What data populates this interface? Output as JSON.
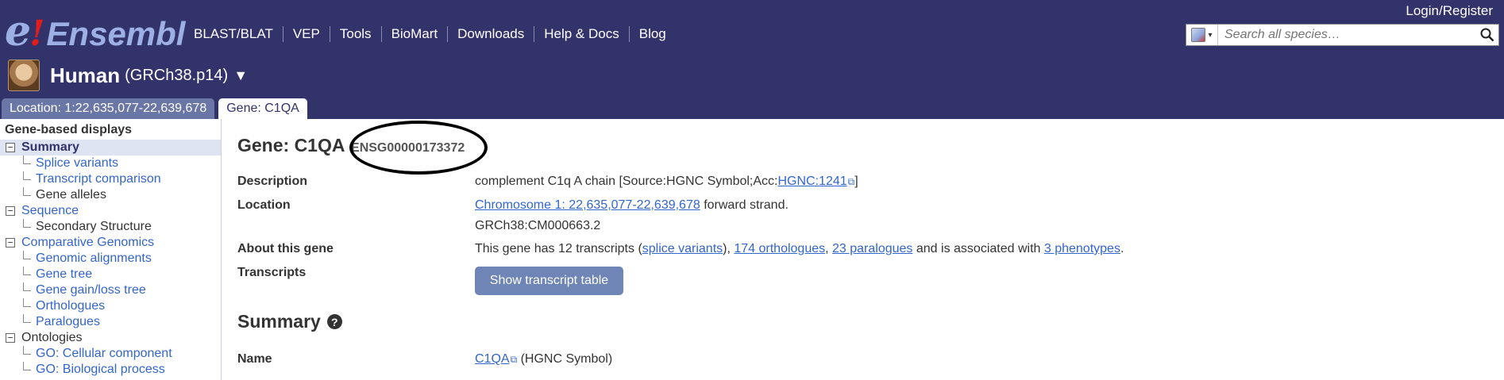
{
  "header": {
    "logo": {
      "e": "e",
      "bang": "!",
      "text": "Ensembl"
    },
    "nav": [
      "BLAST/BLAT",
      "VEP",
      "Tools",
      "BioMart",
      "Downloads",
      "Help & Docs",
      "Blog"
    ],
    "login": "Login/Register",
    "search": {
      "placeholder": "Search all species…",
      "species_icon": "species-selector-icon",
      "button_icon": "magnifier-icon"
    }
  },
  "species": {
    "name": "Human",
    "assembly": "(GRCh38.p14)",
    "dropdown": "▼"
  },
  "tabs": [
    {
      "label": "Location: 1:22,635,077-22,639,678",
      "active": false
    },
    {
      "label": "Gene: C1QA",
      "active": true
    }
  ],
  "sidebar": {
    "title": "Gene-based displays",
    "items": [
      {
        "label": "Summary",
        "level": 1,
        "toggle": "−",
        "link": true,
        "active": true
      },
      {
        "label": "Splice variants",
        "level": 2,
        "link": true
      },
      {
        "label": "Transcript comparison",
        "level": 2,
        "link": true
      },
      {
        "label": "Gene alleles",
        "level": 2,
        "link": false
      },
      {
        "label": "Sequence",
        "level": 1,
        "toggle": "−",
        "link": true
      },
      {
        "label": "Secondary Structure",
        "level": 2,
        "link": false
      },
      {
        "label": "Comparative Genomics",
        "level": 1,
        "toggle": "−",
        "link": true
      },
      {
        "label": "Genomic alignments",
        "level": 2,
        "link": true
      },
      {
        "label": "Gene tree",
        "level": 2,
        "link": true
      },
      {
        "label": "Gene gain/loss tree",
        "level": 2,
        "link": true
      },
      {
        "label": "Orthologues",
        "level": 2,
        "link": true
      },
      {
        "label": "Paralogues",
        "level": 2,
        "link": true
      },
      {
        "label": "Ontologies",
        "level": 1,
        "toggle": "−",
        "link": false
      },
      {
        "label": "GO: Cellular component",
        "level": 2,
        "link": true
      },
      {
        "label": "GO: Biological process",
        "level": 2,
        "link": true
      }
    ]
  },
  "main": {
    "title": "Gene: C1QA",
    "gene_id": "ENSG00000173372",
    "description": {
      "label": "Description",
      "text": "complement C1q A chain [Source:HGNC Symbol;Acc:",
      "link": "HGNC:1241",
      "end": "]"
    },
    "location": {
      "label": "Location",
      "link": "Chromosome 1: 22,635,077-22,639,678",
      "text": " forward strand.",
      "line2": "GRCh38:CM000663.2"
    },
    "about": {
      "label": "About this gene",
      "t1": "This gene has 12 transcripts (",
      "l1": "splice variants",
      "t2": "), ",
      "l2": "174 orthologues",
      "t3": ", ",
      "l3": "23 paralogues",
      "t4": " and is associated with ",
      "l4": "3 phenotypes",
      "t5": "."
    },
    "transcripts": {
      "label": "Transcripts",
      "button": "Show transcript table"
    },
    "summary": {
      "heading": "Summary",
      "help": "?",
      "name_label": "Name",
      "name_link": "C1QA",
      "name_text": " (HGNC Symbol)"
    }
  }
}
